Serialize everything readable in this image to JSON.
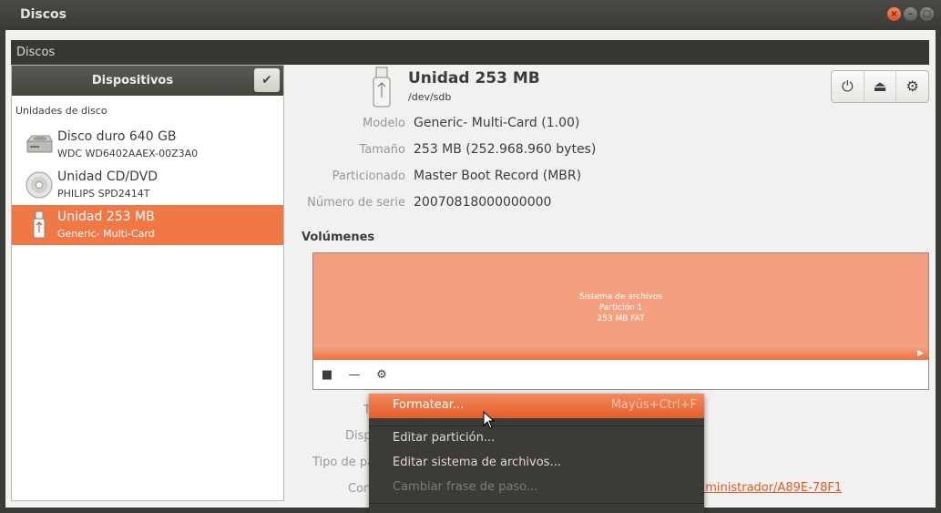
{
  "window": {
    "title": "Discos"
  },
  "menubar": {
    "label": "Discos"
  },
  "sidebar": {
    "header": "Dispositivos",
    "section": "Unidades de disco",
    "items": [
      {
        "name": "Disco duro 640 GB",
        "sub": "WDC WD6402AAEX-00Z3A0",
        "icon": "hard-disk-icon"
      },
      {
        "name": "Unidad CD/DVD",
        "sub": "PHILIPS SPD2414T",
        "icon": "optical-disc-icon"
      },
      {
        "name": "Unidad 253 MB",
        "sub": "Generic- Multi-Card",
        "icon": "usb-drive-icon"
      }
    ]
  },
  "drive": {
    "title": "Unidad 253 MB",
    "path": "/dev/sdb",
    "props": [
      {
        "key": "Modelo",
        "value": "Generic- Multi-Card (1.00)"
      },
      {
        "key": "Tamaño",
        "value": "253 MB (252.968.960 bytes)"
      },
      {
        "key": "Particionado",
        "value": "Master Boot Record (MBR)"
      },
      {
        "key": "Número de serie",
        "value": "20070818000000000"
      }
    ]
  },
  "volumes": {
    "heading": "Volúmenes",
    "partition": {
      "line1": "Sistema de archivos",
      "line2": "Partición 1",
      "line3": "253 MB FAT"
    }
  },
  "lower": {
    "k1": "T",
    "k2": "Disp",
    "k3": "Tipo de pa",
    "k4": "Con",
    "link": "dministrador/A89E-78F1"
  },
  "context_menu": {
    "items": [
      {
        "label": "Formatear...",
        "accel": "Mayús+Ctrl+F"
      },
      {
        "label": "Editar partición..."
      },
      {
        "label": "Editar sistema de archivos..."
      },
      {
        "label": "Cambiar frase de paso..."
      }
    ]
  },
  "colors": {
    "accent": "#f07746",
    "partition": "#f4a080"
  }
}
